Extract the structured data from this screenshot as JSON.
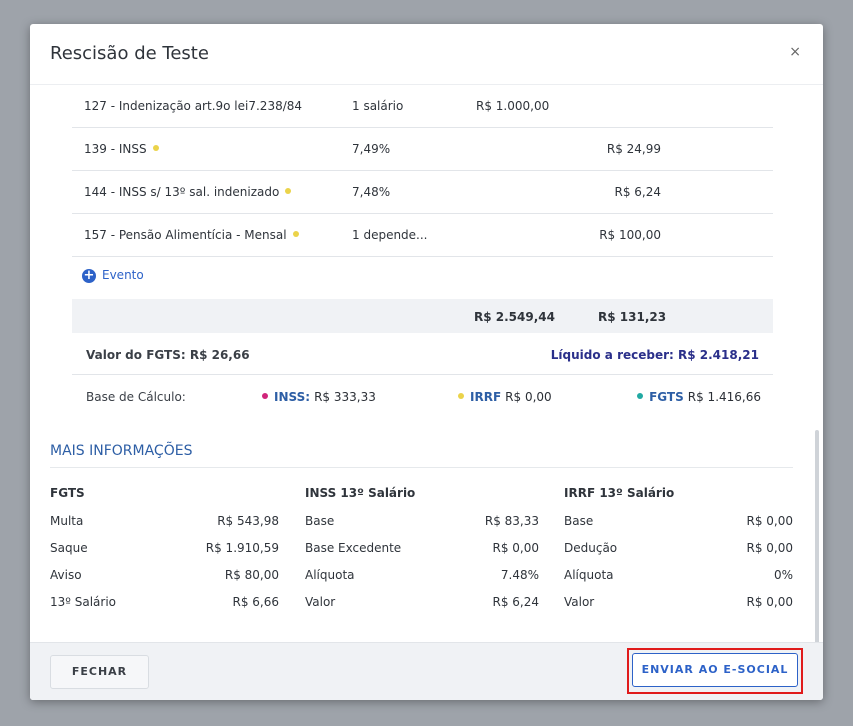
{
  "modal": {
    "title": "Rescisão de Teste",
    "close_glyph": "×"
  },
  "events": [
    {
      "desc": "127 - Indenização art.9o lei7.238/84",
      "ref": "1 salário",
      "prov": "R$ 1.000,00",
      "disc": "",
      "dot": ""
    },
    {
      "desc": "139 - INSS",
      "ref": "7,49%",
      "prov": "",
      "disc": "R$ 24,99",
      "dot": "yellow"
    },
    {
      "desc": "144 - INSS s/ 13º sal. indenizado",
      "ref": "7,48%",
      "prov": "",
      "disc": "R$ 6,24",
      "dot": "yellow"
    },
    {
      "desc": "157 - Pensão Alimentícia - Mensal",
      "ref": "1 depende...",
      "prov": "",
      "disc": "R$ 100,00",
      "dot": "yellow"
    }
  ],
  "add_event": {
    "icon": "+",
    "label": "Evento"
  },
  "totals": {
    "proventos": "R$ 2.549,44",
    "descontos": "R$ 131,23"
  },
  "fgts_value": "Valor do FGTS: R$ 26,66",
  "liquido": "Líquido a receber: R$ 2.418,21",
  "base_calculo": {
    "label": "Base de Cálculo:",
    "inss_key": "INSS:",
    "inss_value": "R$ 333,33",
    "irrf_key": "IRRF",
    "irrf_value": "R$ 0,00",
    "fgts_key": "FGTS",
    "fgts_value": "R$ 1.416,66"
  },
  "mais_info": {
    "title": "MAIS INFORMAÇÕES",
    "fgts": {
      "title": "FGTS",
      "rows": [
        {
          "k": "Multa",
          "v": "R$ 543,98"
        },
        {
          "k": "Saque",
          "v": "R$ 1.910,59"
        },
        {
          "k": "Aviso",
          "v": "R$ 80,00"
        },
        {
          "k": "13º Salário",
          "v": "R$ 6,66"
        }
      ]
    },
    "inss13": {
      "title": "INSS 13º Salário",
      "rows": [
        {
          "k": "Base",
          "v": "R$ 83,33"
        },
        {
          "k": "Base Excedente",
          "v": "R$ 0,00"
        },
        {
          "k": "Alíquota",
          "v": "7.48%"
        },
        {
          "k": "Valor",
          "v": "R$ 6,24"
        }
      ]
    },
    "irrf13": {
      "title": "IRRF 13º Salário",
      "rows": [
        {
          "k": "Base",
          "v": "R$ 0,00"
        },
        {
          "k": "Dedução",
          "v": "R$ 0,00"
        },
        {
          "k": "Alíquota",
          "v": "0%"
        },
        {
          "k": "Valor",
          "v": "R$ 0,00"
        }
      ]
    }
  },
  "footer": {
    "close_label": "FECHAR",
    "send_label": "ENVIAR AO E-SOCIAL"
  },
  "colors": {
    "accent": "#2d62c8",
    "highlight": "#e01b1b",
    "dot_yellow": "#ebd34a",
    "dot_pink": "#d0247a",
    "dot_teal": "#21a9a3"
  }
}
